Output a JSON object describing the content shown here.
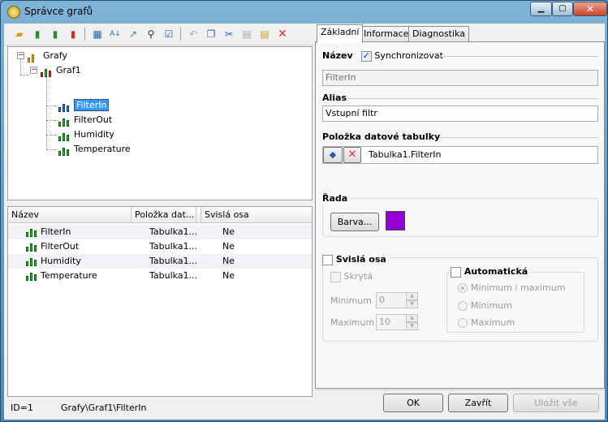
{
  "window": {
    "title": "Správce grafů",
    "minimize": "▁",
    "maximize": "▢",
    "close": "✕"
  },
  "toolbar": {
    "icons": [
      "new-folder-icon",
      "add-chart-icon",
      "add-series-icon",
      "chart-icon",
      "properties-icon",
      "sort-az-icon",
      "move-up-icon",
      "find-icon",
      "check-icon",
      "undo-icon",
      "copy-icon",
      "cut-icon",
      "paste-icon",
      "paste-special-icon",
      "delete-icon"
    ]
  },
  "tree": {
    "root": "Grafy",
    "chart": "Graf1",
    "items": [
      "FilterIn",
      "FilterOut",
      "Humidity",
      "Temperature"
    ],
    "selected": "FilterIn"
  },
  "list": {
    "columns": [
      "Název",
      "Položka dat...",
      "Svislá osa"
    ],
    "rows": [
      {
        "name": "FilterIn",
        "item": "Tabulka1...",
        "axis": "Ne"
      },
      {
        "name": "FilterOut",
        "item": "Tabulka1...",
        "axis": "Ne"
      },
      {
        "name": "Humidity",
        "item": "Tabulka1...",
        "axis": "Ne"
      },
      {
        "name": "Temperature",
        "item": "Tabulka1...",
        "axis": "Ne"
      }
    ]
  },
  "status": {
    "id": "ID=1",
    "path": "Grafy\\Graf1\\FilterIn"
  },
  "tabs": [
    "Základní",
    "Informace",
    "Diagnostika"
  ],
  "basic": {
    "name_label": "Název",
    "sync_label": "Synchronizovat",
    "name_value": "FilterIn",
    "alias_label": "Alias",
    "alias_value": "Vstupní filtr",
    "item_label": "Položka datové tabulky",
    "item_value": "Tabulka1.FilterIn",
    "row_label": "Řada",
    "color_button": "Barva...",
    "color_value": "#9400d3",
    "axis_label": "Svislá osa",
    "hidden_label": "Skrytá",
    "minimum_label": "Minimum",
    "minimum_value": "0",
    "maximum_label": "Maximum",
    "maximum_value": "10",
    "auto_label": "Automatická",
    "radio_minmax": "Minimum i maximum",
    "radio_min": "Minimum",
    "radio_max": "Maximum"
  },
  "buttons": {
    "ok": "OK",
    "close": "Zavřít",
    "save_all": "Uložit vše"
  }
}
